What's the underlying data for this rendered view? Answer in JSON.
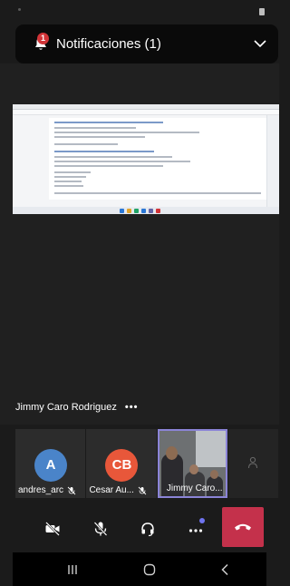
{
  "notification": {
    "title": "Notificaciones (1)",
    "badge_count": "1",
    "icon": "bell-icon",
    "expand_icon": "chevron-down-icon"
  },
  "main_speaker": {
    "name": "Jimmy Caro Rodriguez",
    "more_label": "•••"
  },
  "participants": [
    {
      "initials": "A",
      "name": "andres_arc",
      "color": "#4a84c9",
      "muted": true
    },
    {
      "initials": "CB",
      "name": "Cesar Au...",
      "color": "#e8573a",
      "muted": true
    },
    {
      "name": "Jimmy Caro...",
      "video": true,
      "active": true
    }
  ],
  "controls": {
    "camera": "video-off-icon",
    "mic": "mic-off-icon",
    "audio": "headset-icon",
    "more": "more-icon",
    "hangup": "hang-up-icon"
  },
  "colors": {
    "accent": "#8b84d7",
    "hangup": "#c4314b",
    "badge": "#d13438"
  }
}
